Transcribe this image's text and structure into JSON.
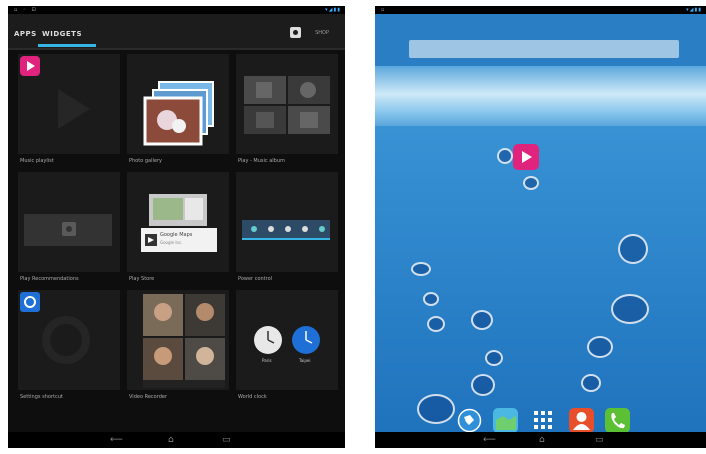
{
  "left_screen": {
    "tabs": [
      "APPS",
      "WIDGETS"
    ],
    "shop_label": "SHOP",
    "widgets": [
      {
        "label": "Music playlist"
      },
      {
        "label": "Photo gallery"
      },
      {
        "label": "Play - Music album"
      },
      {
        "label": "Play Recommendations"
      },
      {
        "label": "Play Store"
      },
      {
        "label": "Power control"
      },
      {
        "label": "Settings shortcut"
      },
      {
        "label": "Video Recorder"
      },
      {
        "label": "World clock"
      }
    ],
    "store_widget_title": "Google Maps",
    "store_widget_sub": "Google Inc.",
    "clock_labels": [
      "Paris",
      "Taipei"
    ],
    "colors": {
      "accent": "#35b5e5",
      "background": "#0e0e0e"
    }
  },
  "right_screen": {
    "dock_icons": [
      "browser-icon",
      "maps-icon",
      "all-apps-icon",
      "contacts-icon",
      "phone-icon"
    ]
  },
  "navbar_icons": [
    "back-icon",
    "home-icon",
    "recents-icon"
  ]
}
